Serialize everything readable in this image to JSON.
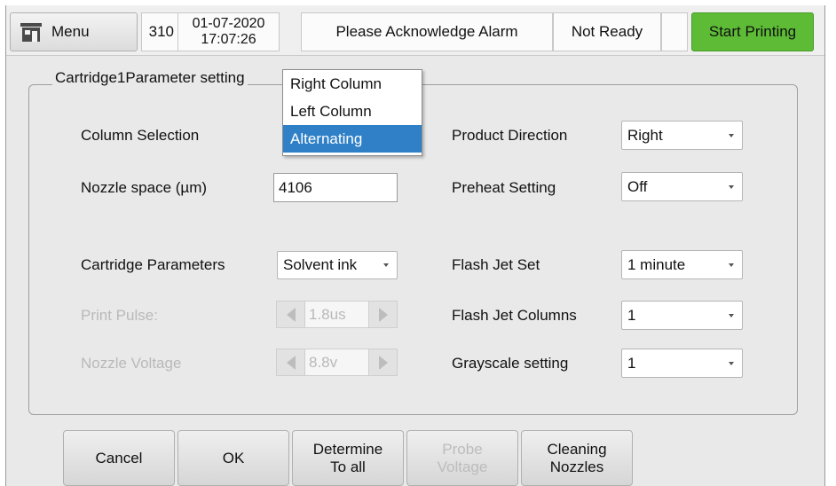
{
  "topbar": {
    "menu_label": "Menu",
    "count": "310",
    "date": "01-07-2020",
    "time": "17:07:26",
    "alarm_text": "Please Acknowledge Alarm",
    "status_text": "Not Ready",
    "start_label": "Start Printing",
    "start_color": "#5dbb36",
    "menu_icon": "home-icon"
  },
  "group": {
    "title": "Cartridge1Parameter setting"
  },
  "fields": {
    "column_selection": {
      "label": "Column Selection"
    },
    "nozzle_space": {
      "label": "Nozzle space (µm)",
      "value": "4106"
    },
    "cartridge_parameters": {
      "label": "Cartridge Parameters",
      "value": "Solvent ink"
    },
    "print_pulse": {
      "label": "Print Pulse:",
      "value": "1.8us"
    },
    "nozzle_voltage": {
      "label": "Nozzle Voltage",
      "value": "8.8v"
    },
    "product_direction": {
      "label": "Product Direction",
      "value": "Right"
    },
    "preheat_setting": {
      "label": "Preheat Setting",
      "value": "Off"
    },
    "flash_jet_set": {
      "label": "Flash Jet Set",
      "value": "1 minute"
    },
    "flash_jet_columns": {
      "label": "Flash Jet Columns",
      "value": "1"
    },
    "grayscale_setting": {
      "label": "Grayscale setting",
      "value": "1"
    }
  },
  "column_dropdown": {
    "options": [
      "Right Column",
      "Left Column",
      "Alternating"
    ],
    "selected": "Alternating",
    "highlight_color": "#2f80c7"
  },
  "bottom": {
    "cancel": "Cancel",
    "ok": "OK",
    "determine": "Determine\nTo all",
    "probe": "Probe\nVoltage",
    "cleaning": "Cleaning\nNozzles"
  }
}
